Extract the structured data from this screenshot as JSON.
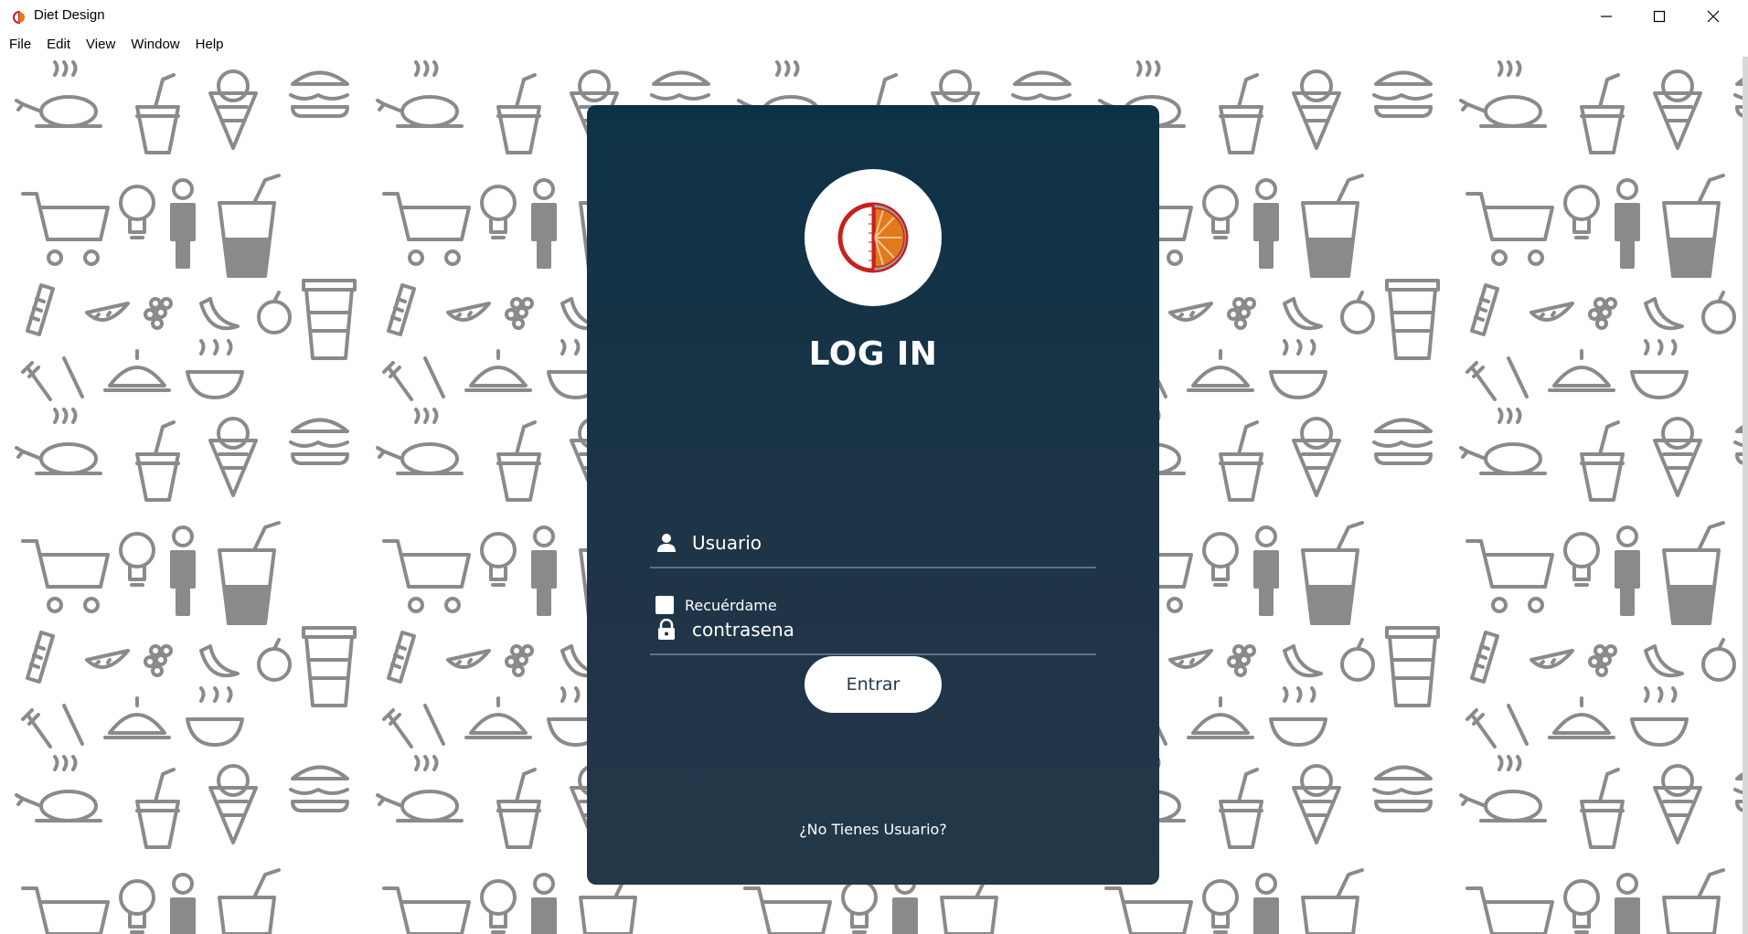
{
  "window": {
    "title": "Diet Design",
    "app_icon": "diet-logo-icon",
    "controls": [
      "minimize-icon",
      "maximize-icon",
      "close-icon"
    ]
  },
  "menubar": {
    "items": [
      "File",
      "Edit",
      "View",
      "Window",
      "Help"
    ]
  },
  "background": {
    "pattern": "food-doodle-pattern",
    "pattern_color": "#8a8a8a"
  },
  "login": {
    "logo": "diet-logo-icon",
    "title": "LOG IN",
    "username": {
      "icon": "user-icon",
      "placeholder": "Usuario",
      "value": ""
    },
    "password": {
      "icon": "lock-icon",
      "placeholder": "contrasena",
      "value": ""
    },
    "remember_label": "Recuérdame",
    "remember_checked": false,
    "submit_label": "Entrar",
    "register_link": "¿No Tienes Usuario?"
  },
  "colors": {
    "card_top": "#0d3246",
    "card_bottom": "#233848",
    "logo_red": "#c8201e",
    "logo_orange": "#e07a1c",
    "field_line": "#5f7382"
  }
}
